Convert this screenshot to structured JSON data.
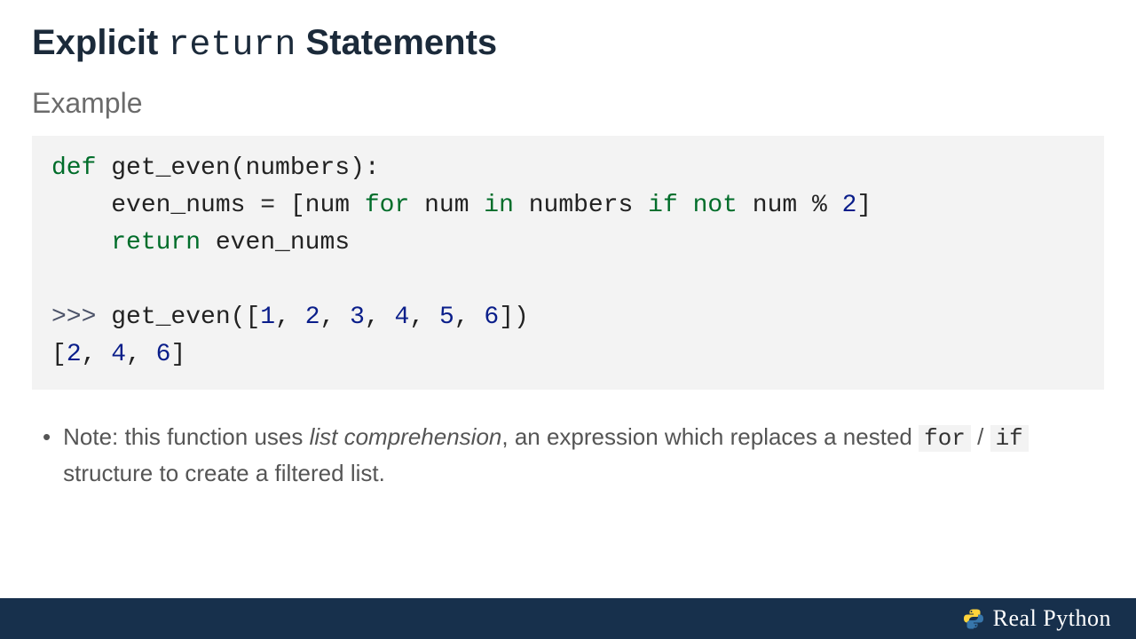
{
  "heading": {
    "part1": "Explicit ",
    "code": "return",
    "part2": "  Statements"
  },
  "subhead": "Example",
  "code": {
    "l1_def": "def",
    "l1_rest": " get_even(numbers):",
    "l2_a": "    even_nums = [num ",
    "l2_for": "for",
    "l2_b": " num ",
    "l2_in": "in",
    "l2_c": " numbers ",
    "l2_if": "if",
    "l2_d": " ",
    "l2_not": "not",
    "l2_e": " num % ",
    "l2_num2": "2",
    "l2_f": "]",
    "l3_ret": "    return",
    "l3_rest": " even_nums",
    "blank": "",
    "l4_prompt": ">>>",
    "l4_a": " get_even([",
    "n1": "1",
    "c": ", ",
    "n2": "2",
    "n3": "3",
    "n4": "4",
    "n5": "5",
    "n6": "6",
    "l4_end": "])",
    "l5_a": "[",
    "r1": "2",
    "r2": "4",
    "r3": "6",
    "l5_end": "]"
  },
  "note": {
    "prefix": "Note: this function uses ",
    "emph": "list comprehension",
    "mid1": ", an expression which replaces a nested ",
    "for": "for",
    "slash": " / ",
    "if": "if",
    "tail": " structure to create a filtered list."
  },
  "footer": {
    "brand": "Real Python"
  }
}
